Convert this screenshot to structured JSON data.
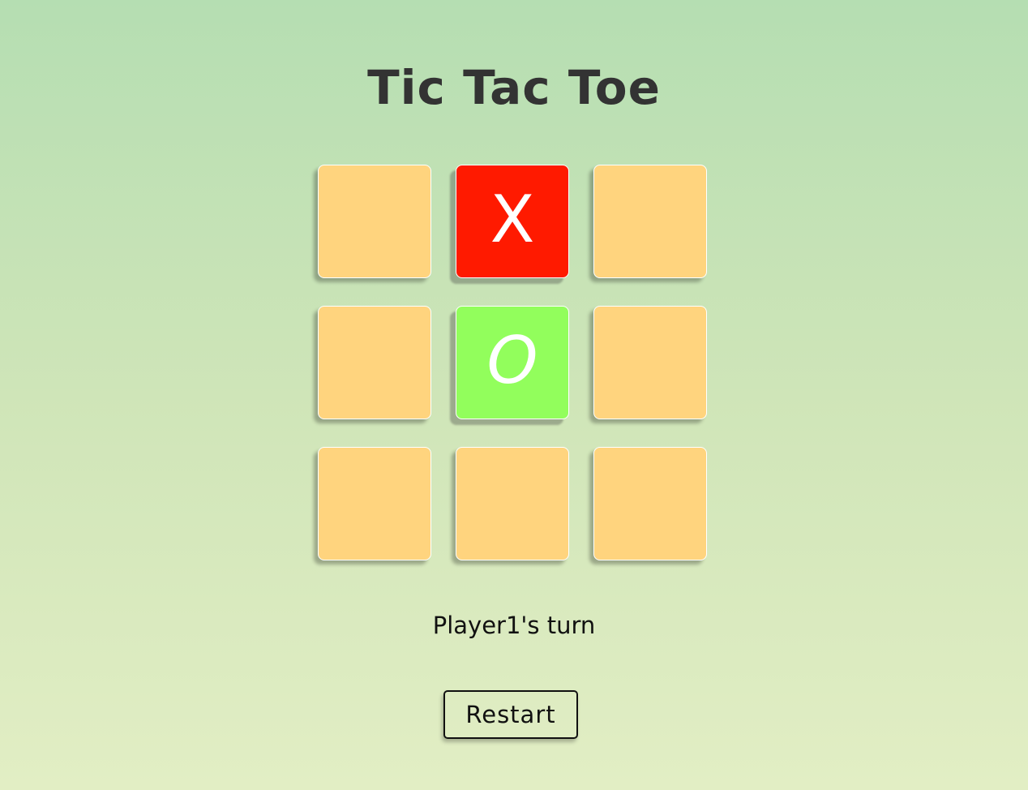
{
  "game": {
    "title": "Tic Tac Toe",
    "board": [
      {
        "mark": "",
        "state": "empty"
      },
      {
        "mark": "X",
        "state": "x"
      },
      {
        "mark": "",
        "state": "empty"
      },
      {
        "mark": "",
        "state": "empty"
      },
      {
        "mark": "O",
        "state": "o"
      },
      {
        "mark": "",
        "state": "empty"
      },
      {
        "mark": "",
        "state": "empty"
      },
      {
        "mark": "",
        "state": "empty"
      },
      {
        "mark": "",
        "state": "empty"
      }
    ],
    "status": "Player1's turn",
    "restart_label": "Restart"
  },
  "colors": {
    "empty_cell": "#ffd47e",
    "x_cell": "#ff1a00",
    "o_cell": "#92fe5c",
    "mark": "#ffffff",
    "title": "#333333"
  }
}
